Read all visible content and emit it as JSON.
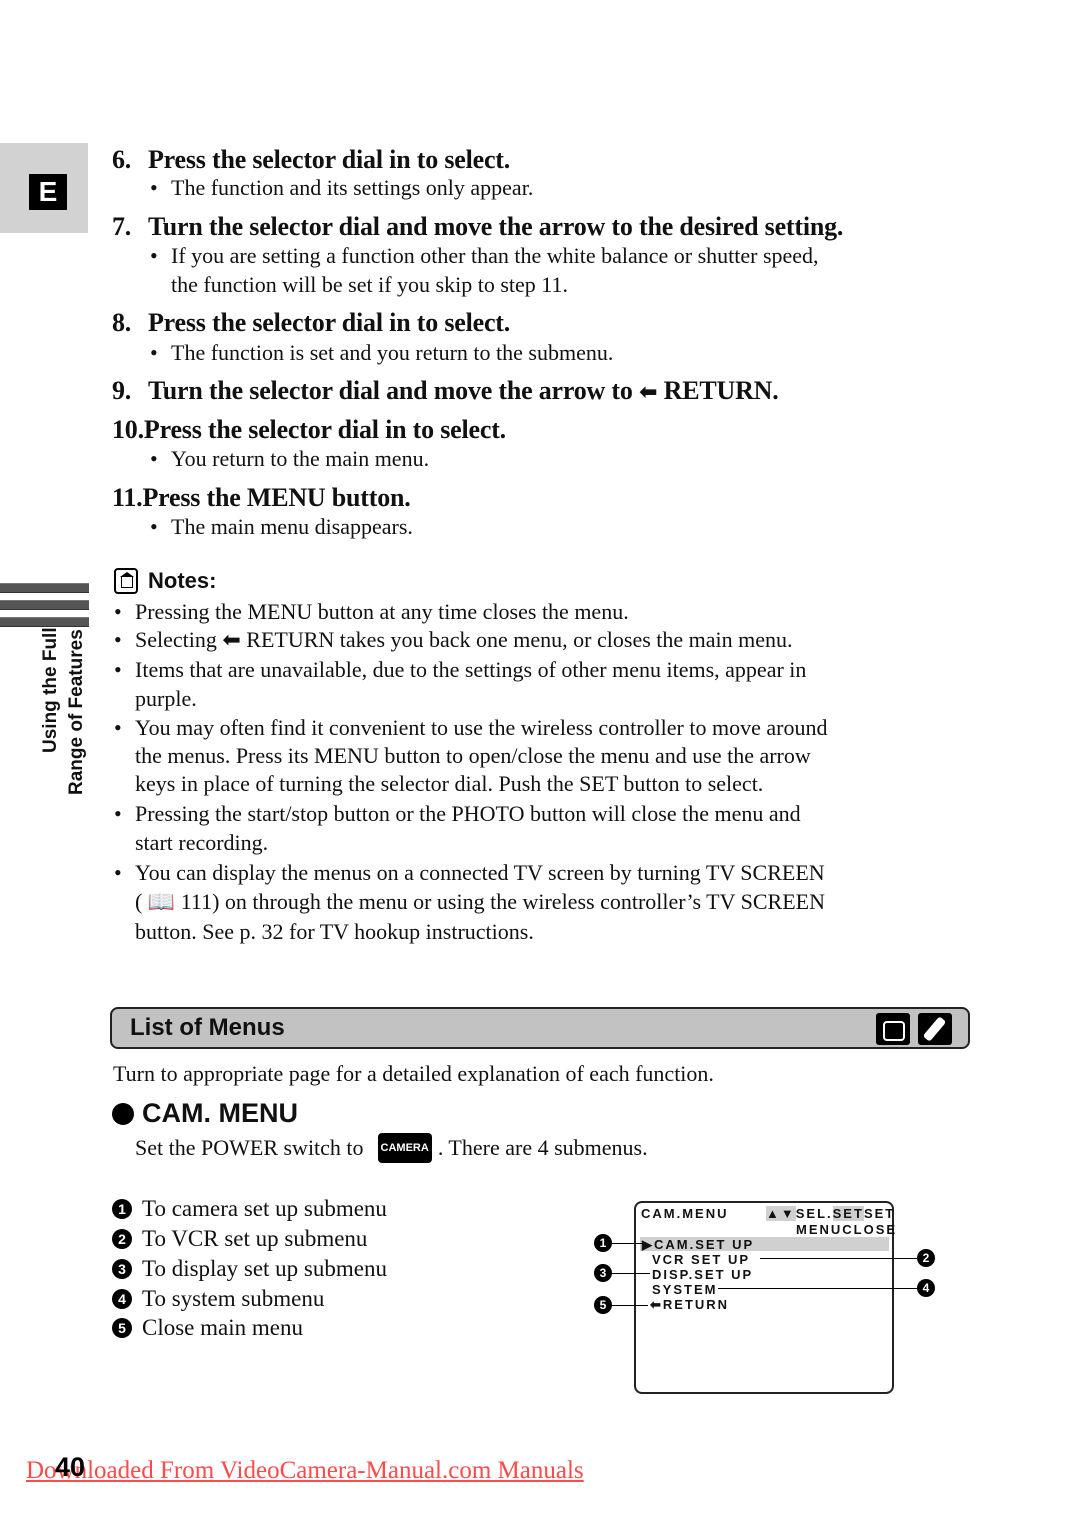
{
  "side_tab": {
    "language": "E",
    "section_line1": "Using the Full",
    "section_line2": "Range of Features"
  },
  "steps": [
    {
      "num": "6.",
      "text": "Press the selector dial in to select.",
      "bullets": [
        "The function and its settings only appear."
      ]
    },
    {
      "num": "7.",
      "text": "Turn the selector dial and move the arrow to the desired setting.",
      "bullets": [
        "If you are setting a function other than the white balance or shutter speed,",
        "the function will be set if you skip to step 11."
      ]
    },
    {
      "num": "8.",
      "text": "Press the selector dial in to select.",
      "bullets": [
        "The function is set and you return to the submenu."
      ]
    },
    {
      "num": "9.",
      "text_before": "Turn the selector dial and move the arrow to",
      "arrow_icon": "⬅",
      "text_after": "RETURN."
    },
    {
      "num": "10.",
      "text": "Press the selector dial in to select.",
      "bullets": [
        "You return to the main menu."
      ]
    },
    {
      "num": "11.",
      "text": "Press the MENU button.",
      "bullets": [
        "The main menu disappears."
      ]
    }
  ],
  "notes": {
    "title": "Notes:",
    "items": [
      [
        "Pressing the MENU button at any time closes the menu."
      ],
      [
        "Selecting ⬅ RETURN takes you back one menu, or closes the main menu."
      ],
      [
        "Items that are unavailable, due to the settings of other menu items, appear in",
        "purple."
      ],
      [
        "You may often find it convenient to use the wireless controller to move around",
        "the menus. Press its MENU button to open/close the menu and use the arrow",
        "keys in place of turning the selector dial. Push the SET button to select."
      ],
      [
        "Pressing the start/stop button or the PHOTO button will close the menu and",
        "start recording."
      ],
      [
        "You can display the menus on a connected TV screen by turning TV SCREEN",
        "( 📖 111) on through the menu or using the wireless controller’s TV SCREEN",
        "button. See p. 32 for TV hookup instructions."
      ]
    ]
  },
  "list_of_menus": {
    "title": "List of Menus",
    "icons": [
      "camera-mode-icon",
      "wireless-controller-icon"
    ],
    "intro": "Turn to appropriate page for a detailed explanation of each function."
  },
  "cam_menu": {
    "title": "CAM. MENU",
    "power_before": "Set the POWER switch to",
    "power_badge": "CAMERA",
    "power_after": ". There are 4 submenus.",
    "submenus": [
      {
        "n": "1",
        "text": "To camera set up submenu"
      },
      {
        "n": "2",
        "text": "To VCR set up submenu"
      },
      {
        "n": "3",
        "text": "To display set up submenu"
      },
      {
        "n": "4",
        "text": "To system submenu"
      },
      {
        "n": "5",
        "text": "Close main menu"
      }
    ],
    "screen": {
      "header_left": "CAM.MENU",
      "header_arrows": "▲▼",
      "header_sel": "SEL.",
      "header_set1": "SET",
      "header_set2": "SET",
      "header_menu": "MENU",
      "header_close": "CLOSE",
      "rows": [
        "▶CAM.SET UP",
        "VCR SET UP",
        "DISP.SET UP",
        "SYSTEM",
        "⬅RETURN"
      ]
    }
  },
  "footer": {
    "page_number": "40",
    "link_text": "Downloaded From VideoCamera-Manual.com Manuals",
    "link_color": "#ff4a4a"
  }
}
